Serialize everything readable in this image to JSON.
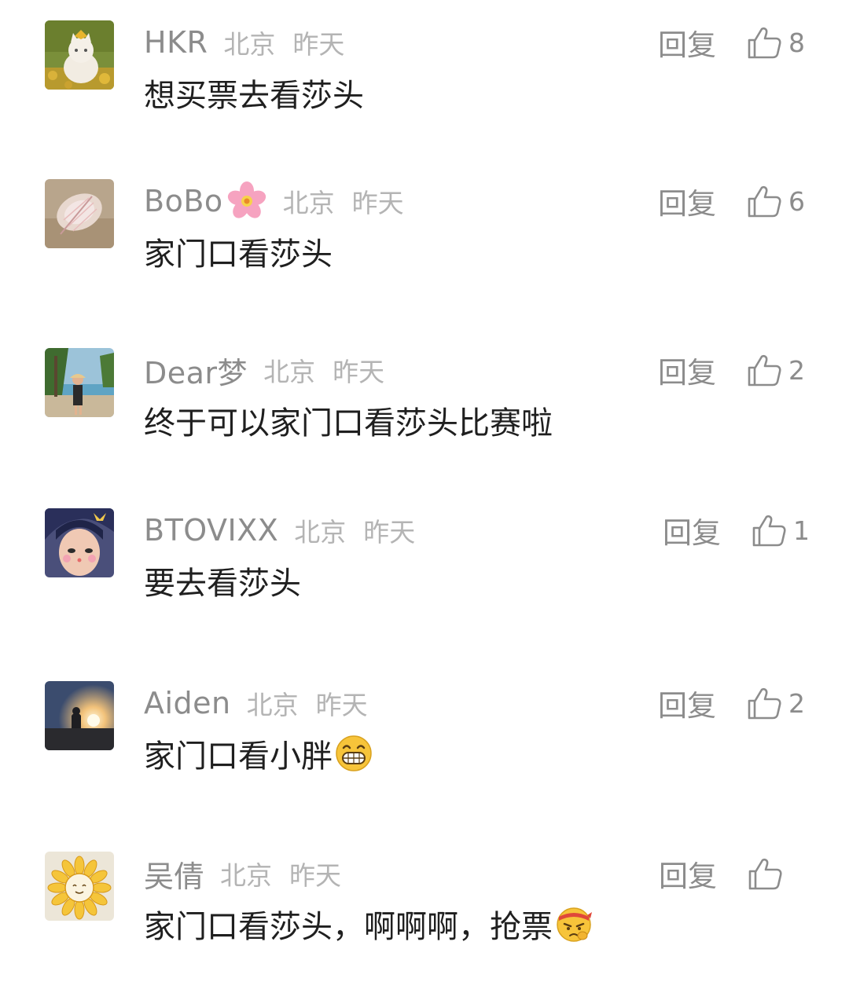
{
  "comments": [
    {
      "username": "HKR",
      "location": "北京",
      "time": "昨天",
      "text": "想买票去看莎头",
      "reply_label": "回复",
      "likes": "8",
      "avatar_icon": "cat-photo-avatar"
    },
    {
      "username": "BoBo",
      "name_emoji": "cherry-blossom-emoji",
      "location": "北京",
      "time": "昨天",
      "text": "家门口看莎头",
      "reply_label": "回复",
      "likes": "6",
      "avatar_icon": "feather-photo-avatar"
    },
    {
      "username": "Dear梦",
      "location": "北京",
      "time": "昨天",
      "text": "终于可以家门口看莎头比赛啦",
      "reply_label": "回复",
      "likes": "2",
      "avatar_icon": "beach-photo-avatar"
    },
    {
      "username": "BTOVIXX",
      "location": "北京",
      "time": "昨天",
      "text": "要去看莎头",
      "reply_label": "回复",
      "likes": "1",
      "avatar_icon": "selfie-photo-avatar"
    },
    {
      "username": "Aiden",
      "location": "北京",
      "time": "昨天",
      "text": "家门口看小胖",
      "text_emoji": "grinning-face-emoji",
      "reply_label": "回复",
      "likes": "2",
      "avatar_icon": "sunset-photo-avatar"
    },
    {
      "username": "吴倩",
      "location": "北京",
      "time": "昨天",
      "text": "家门口看莎头，啊啊啊，抢票",
      "text_emoji": "determined-face-emoji",
      "reply_label": "回复",
      "likes": "",
      "avatar_icon": "sunflower-drawing-avatar"
    }
  ],
  "colors": {
    "meta_text": "#8c8c8c",
    "location_text": "#b4b4b4",
    "body_text": "#1f1f1f",
    "background": "#ffffff"
  }
}
